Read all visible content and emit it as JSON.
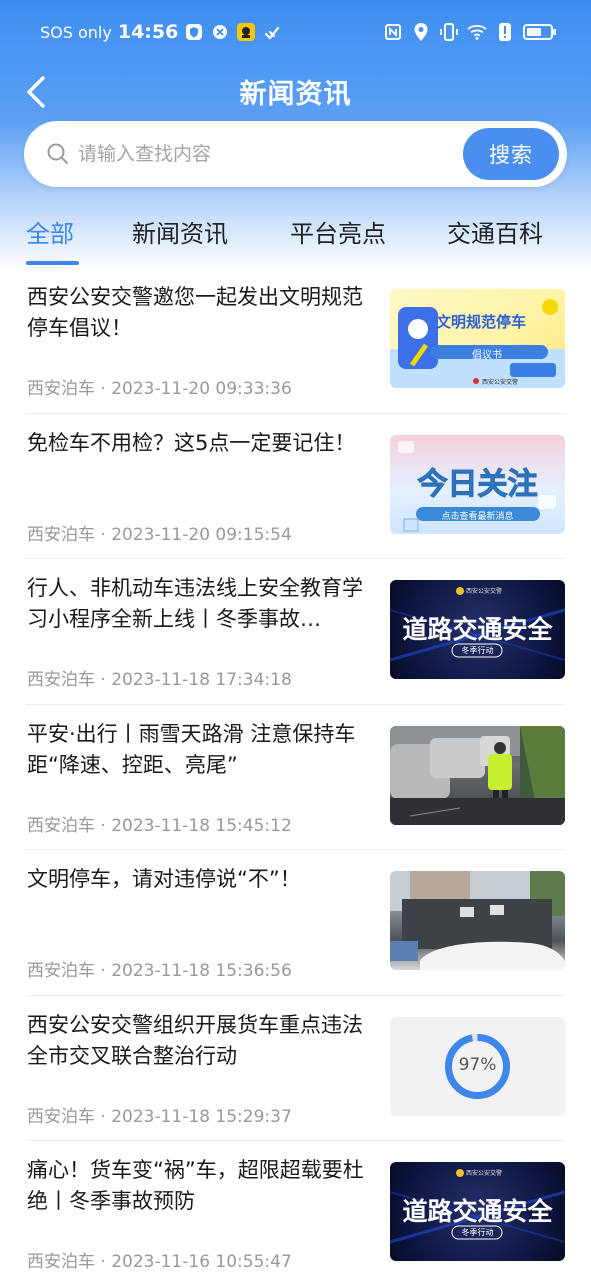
{
  "status_bar": {
    "sos": "SOS only",
    "time": "14:56"
  },
  "header": {
    "title": "新闻资讯"
  },
  "search": {
    "placeholder": "请输入查找内容",
    "button_label": "搜索"
  },
  "tabs": [
    {
      "label": "全部",
      "active": true
    },
    {
      "label": "新闻资讯",
      "active": false
    },
    {
      "label": "平台亮点",
      "active": false
    },
    {
      "label": "交通百科",
      "active": false
    }
  ],
  "news": [
    {
      "title": "西安公安交警邀您一起发出文明规范停车倡议！",
      "meta": "西安泊车 · 2023-11-20 09:33:36",
      "thumb": {
        "heading": "文明规范停车",
        "sub": "倡议书",
        "footer": "西安公安交警"
      }
    },
    {
      "title": "免检车不用检？这5点一定要记住！",
      "meta": "西安泊车 · 2023-11-20 09:15:54",
      "thumb": {
        "heading": "今日关注",
        "sub": "点击查看最新消息"
      }
    },
    {
      "title": "行人、非机动车违法线上安全教育学习小程序全新上线丨冬季事故…",
      "meta": "西安泊车 · 2023-11-18 17:34:18",
      "thumb": {
        "heading": "道路交通安全",
        "sub": "冬季行动",
        "footer": "西安公安交警"
      }
    },
    {
      "title": "平安·出行丨雨雪天路滑 注意保持车距“降速、控距、亮尾”",
      "meta": "西安泊车 · 2023-11-18 15:45:12",
      "thumb": {}
    },
    {
      "title": "文明停车，请对违停说“不”！",
      "meta": "西安泊车 · 2023-11-18 15:36:56",
      "thumb": {}
    },
    {
      "title": "西安公安交警组织开展货车重点违法全市交叉联合整治行动",
      "meta": "西安泊车 · 2023-11-18 15:29:37",
      "thumb": {
        "progress_label": "97%",
        "progress": 0.97
      }
    },
    {
      "title": "痛心！货车变“祸”车，超限超载要杜绝丨冬季事故预防",
      "meta": "西安泊车 · 2023-11-16 10:55:47",
      "thumb": {
        "heading": "道路交通安全",
        "sub": "冬季行动",
        "footer": "西安公安交警"
      }
    }
  ],
  "colors": {
    "accent": "#3e86ea",
    "header_blue": "#3d8ef2",
    "meta_gray": "#999999"
  },
  "icons": {
    "back": "chevron-left-icon",
    "search": "search-icon"
  },
  "battery": {
    "level": 0.65
  }
}
